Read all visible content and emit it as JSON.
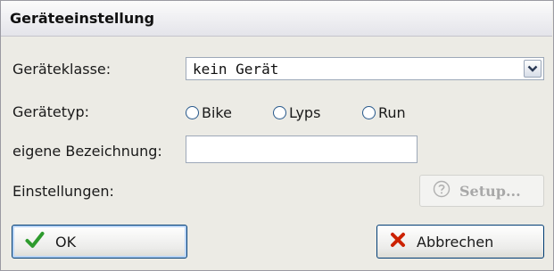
{
  "dialog": {
    "title": "Geräteeinstellung"
  },
  "form": {
    "geraeteklasse_label": "Geräteklasse:",
    "geraeteklasse_value": "kein Gerät",
    "geraetetyp_label": "Gerätetyp:",
    "geraetetyp_options": [
      "Bike",
      "Lyps",
      "Run"
    ],
    "geraetetyp_selected": "",
    "bezeichnung_label": "eigene Bezeichnung:",
    "bezeichnung_value": "",
    "einstellungen_label": "Einstellungen:"
  },
  "buttons": {
    "setup_label": "Setup...",
    "ok_label": "OK",
    "cancel_label": "Abbrechen"
  },
  "icons": {
    "combo_arrow": "chevron-down-icon",
    "setup": "help-circle-icon",
    "ok": "checkmark-icon",
    "cancel": "x-icon"
  },
  "colors": {
    "ok_check": "#2e9b2e",
    "cancel_x": "#cc2200",
    "dialog_bg": "#ecebe5"
  }
}
